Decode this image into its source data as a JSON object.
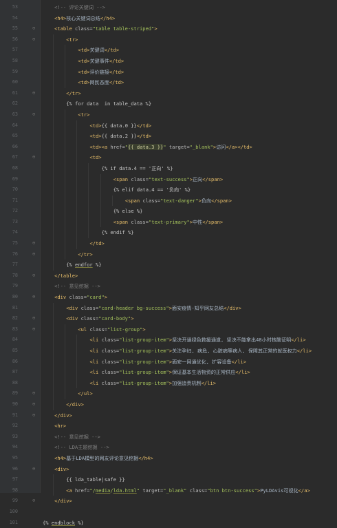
{
  "editor": {
    "lines": [
      {
        "n": "53",
        "ind": 2,
        "fold": "",
        "html": "<span class=cmt>&lt;!-- 评论关键词 --&gt;</span>"
      },
      {
        "n": "54",
        "ind": 2,
        "fold": "",
        "html": "<span class=tag>&lt;h4&gt;</span><span class=txt>核心关键词总结</span><span class=tag>&lt;/h4&gt;</span>"
      },
      {
        "n": "55",
        "ind": 2,
        "fold": "⊖",
        "html": "<span class=tag>&lt;table </span><span class=attr>class=</span><span class=val>\"table table-striped\"</span><span class=tag>&gt;</span>"
      },
      {
        "n": "56",
        "ind": 4,
        "fold": "⊖",
        "html": "<span class=tag>&lt;tr&gt;</span>"
      },
      {
        "n": "57",
        "ind": 6,
        "fold": "",
        "html": "<span class=tag>&lt;td&gt;</span><span class=txt>关键词</span><span class=tag>&lt;/td&gt;</span>"
      },
      {
        "n": "58",
        "ind": 6,
        "fold": "",
        "html": "<span class=tag>&lt;td&gt;</span><span class=txt>关键事件</span><span class=tag>&lt;/td&gt;</span>"
      },
      {
        "n": "59",
        "ind": 6,
        "fold": "",
        "html": "<span class=tag>&lt;td&gt;</span><span class=txt>评价链接</span><span class=tag>&lt;/td&gt;</span>"
      },
      {
        "n": "60",
        "ind": 6,
        "fold": "",
        "html": "<span class=tag>&lt;td&gt;</span><span class=txt>网民态度</span><span class=tag>&lt;/td&gt;</span>"
      },
      {
        "n": "61",
        "ind": 4,
        "fold": "⊖",
        "html": "<span class=tag>&lt;/tr&gt;</span>"
      },
      {
        "n": "62",
        "ind": 4,
        "fold": "",
        "html": "<span class=tpl>{% for data  in table_data %}</span>"
      },
      {
        "n": "63",
        "ind": 6,
        "fold": "⊖",
        "html": "<span class=tag>&lt;tr&gt;</span>"
      },
      {
        "n": "64",
        "ind": 8,
        "fold": "",
        "html": "<span class=tag>&lt;td&gt;</span><span class=tpl>{{ data.0 }}</span><span class=tag>&lt;/td&gt;</span>"
      },
      {
        "n": "65",
        "ind": 8,
        "fold": "",
        "html": "<span class=tag>&lt;td&gt;</span><span class=tpl>{{ data.2 }}</span><span class=tag>&lt;/td&gt;</span>"
      },
      {
        "n": "66",
        "ind": 8,
        "fold": "",
        "html": "<span class=tag>&lt;td&gt;&lt;a </span><span class=attr>href=</span><span class=val>\"</span><span class=tpl-hl>{{ data.3 }}</span><span class=val>\"</span> <span class=attr>target=</span><span class=val>\"_blank\"</span><span class=tag>&gt;</span><span class=txt>访问</span><span class=tag>&lt;/a&gt;&lt;/td&gt;</span>"
      },
      {
        "n": "67",
        "ind": 8,
        "fold": "⊖",
        "html": "<span class=tag>&lt;td&gt;</span>"
      },
      {
        "n": "68",
        "ind": 10,
        "fold": "",
        "html": "<span class=tpl>{% if data.4 == '正向' %}</span>"
      },
      {
        "n": "69",
        "ind": 12,
        "fold": "",
        "html": "<span class=tag>&lt;span </span><span class=attr>class=</span><span class=val>\"text-success\"</span><span class=tag>&gt;</span><span class=txt>正向</span><span class=tag>&lt;/span&gt;</span>"
      },
      {
        "n": "70",
        "ind": 12,
        "fold": "",
        "html": "<span class=tpl>{% elif data.4 == '负向' %}</span>"
      },
      {
        "n": "71",
        "ind": 14,
        "fold": "",
        "html": "<span class=tag>&lt;span </span><span class=attr>class=</span><span class=val>\"text-danger\"</span><span class=tag>&gt;</span><span class=txt>负向</span><span class=tag>&lt;/span&gt;</span>"
      },
      {
        "n": "72",
        "ind": 12,
        "fold": "",
        "html": "<span class=tpl>{% else %}</span>"
      },
      {
        "n": "73",
        "ind": 12,
        "fold": "",
        "html": "<span class=tag>&lt;span </span><span class=attr>class=</span><span class=val>\"text-primary\"</span><span class=tag>&gt;</span><span class=txt>中性</span><span class=tag>&lt;/span&gt;</span>"
      },
      {
        "n": "74",
        "ind": 10,
        "fold": "",
        "html": "<span class=tpl>{% endif %}</span>"
      },
      {
        "n": "75",
        "ind": 8,
        "fold": "⊖",
        "html": "<span class=tag>&lt;/td&gt;</span>"
      },
      {
        "n": "76",
        "ind": 6,
        "fold": "⊖",
        "html": "<span class=tag>&lt;/tr&gt;</span>"
      },
      {
        "n": "77",
        "ind": 4,
        "fold": "",
        "html": "<span class=tpl>{% <span class=u>endfor</span> %}</span>"
      },
      {
        "n": "78",
        "ind": 2,
        "fold": "⊖",
        "html": "<span class=tag>&lt;/table&gt;</span>"
      },
      {
        "n": "79",
        "ind": 2,
        "fold": "",
        "html": "<span class=cmt>&lt;!-- 意见挖掘 --&gt;</span>"
      },
      {
        "n": "80",
        "ind": 2,
        "fold": "⊖",
        "html": "<span class=tag>&lt;div </span><span class=attr>class=</span><span class=val>\"card\"</span><span class=tag>&gt;</span>"
      },
      {
        "n": "81",
        "ind": 4,
        "fold": "",
        "html": "<span class=tag>&lt;div </span><span class=attr>class=</span><span class=val>\"card-header bg-success\"</span><span class=tag>&gt;</span><span class=txt>面安疫情-知乎网友总结</span><span class=tag>&lt;/div&gt;</span>"
      },
      {
        "n": "82",
        "ind": 4,
        "fold": "⊖",
        "html": "<span class=tag>&lt;div </span><span class=attr>class=</span><span class=val>\"card-body\"</span><span class=tag>&gt;</span>"
      },
      {
        "n": "83",
        "ind": 6,
        "fold": "⊖",
        "html": "<span class=tag>&lt;ul </span><span class=attr>class=</span><span class=val>\"list-group\"</span><span class=tag>&gt;</span>"
      },
      {
        "n": "84",
        "ind": 8,
        "fold": "",
        "html": "<span class=tag>&lt;li </span><span class=attr>class=</span><span class=val>\"list-group-item\"</span><span class=tag>&gt;</span><span class=txt>坚决开通绿色救援通道, 坚决不能拿出48小时核酸证明</span><span class=tag>&lt;/li&gt;</span>"
      },
      {
        "n": "85",
        "ind": 8,
        "fold": "",
        "html": "<span class=tag>&lt;li </span><span class=attr>class=</span><span class=val>\"list-group-item\"</span><span class=tag>&gt;</span><span class=txt>关注孕妇, 病危, 心脏病等病人, 保障其正常的就医权力</span><span class=tag>&lt;/li&gt;</span>"
      },
      {
        "n": "86",
        "ind": 8,
        "fold": "",
        "html": "<span class=tag>&lt;li </span><span class=attr>class=</span><span class=val>\"list-group-item\"</span><span class=tag>&gt;</span><span class=txt>面安一网通优化, 扩容设备</span><span class=tag>&lt;/li&gt;</span>"
      },
      {
        "n": "87",
        "ind": 8,
        "fold": "",
        "html": "<span class=tag>&lt;li </span><span class=attr>class=</span><span class=val>\"list-group-item\"</span><span class=tag>&gt;</span><span class=txt>保证基本生活物资的正常供应</span><span class=tag>&lt;/li&gt;</span>"
      },
      {
        "n": "88",
        "ind": 8,
        "fold": "",
        "html": "<span class=tag>&lt;li </span><span class=attr>class=</span><span class=val>\"list-group-item\"</span><span class=tag>&gt;</span><span class=txt>加强追责机制</span><span class=tag>&lt;/li&gt;</span>"
      },
      {
        "n": "89",
        "ind": 6,
        "fold": "⊖",
        "html": "<span class=tag>&lt;/ul&gt;</span>"
      },
      {
        "n": "90",
        "ind": 4,
        "fold": "⊖",
        "html": "<span class=tag>&lt;/div&gt;</span>"
      },
      {
        "n": "91",
        "ind": 2,
        "fold": "⊖",
        "html": "<span class=tag>&lt;/div&gt;</span>"
      },
      {
        "n": "92",
        "ind": 2,
        "fold": "",
        "html": "<span class=tag>&lt;hr&gt;</span>"
      },
      {
        "n": "93",
        "ind": 2,
        "fold": "",
        "html": "<span class=cmt>&lt;!-- 意见挖掘 --&gt;</span>"
      },
      {
        "n": "94",
        "ind": 2,
        "fold": "",
        "html": "<span class=cmt>&lt;!-- LDA主题挖掘 --&gt;</span>"
      },
      {
        "n": "95",
        "ind": 2,
        "fold": "",
        "html": "<span class=tag>&lt;h4&gt;</span><span class=txt>基于LDA模型的网友评论意见挖掘</span><span class=tag>&lt;/h4&gt;</span>"
      },
      {
        "n": "96",
        "ind": 2,
        "fold": "⊖",
        "html": "<span class=tag>&lt;div&gt;</span>"
      },
      {
        "n": "97",
        "ind": 4,
        "fold": "",
        "html": "<span class=tpl>{{ lda_table|safe }}</span>"
      },
      {
        "n": "98",
        "ind": 4,
        "fold": "",
        "html": "<span class=tag>&lt;a </span><span class=attr>href=</span><span class=val>\"/<span class=u>media</span>/<span class=u>lda.html</span>\"</span> <span class=attr>target=</span><span class=val>\"_blank\"</span> <span class=attr>class=</span><span class=val>\"btn btn-success\"</span><span class=tag>&gt;</span><span class=txt>PyLDAvis可视化</span><span class=tag>&lt;/a&gt;</span>"
      },
      {
        "n": "99",
        "ind": 2,
        "fold": "⊖",
        "html": "<span class=tag>&lt;/div&gt;</span>"
      },
      {
        "n": "100",
        "ind": 0,
        "fold": "",
        "html": ""
      },
      {
        "n": "101",
        "ind": 0,
        "fold": "",
        "html": "<span class=tpl>{% <span class=u>endblock</span> %}</span>"
      }
    ]
  }
}
